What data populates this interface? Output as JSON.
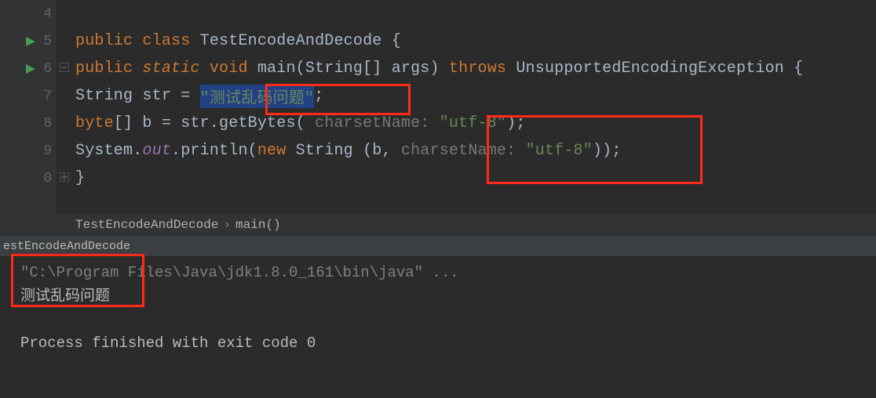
{
  "gutter": {
    "lines": [
      "4",
      "5",
      "6",
      "7",
      "8",
      "9",
      "0"
    ],
    "runMarkers": [
      1,
      2
    ],
    "foldOpen": 2,
    "foldClose": 6
  },
  "code": {
    "l5": {
      "kw1": "public ",
      "kw2": "class ",
      "name": "TestEncodeAndDecode ",
      "brace": "{"
    },
    "l6": {
      "kw1": "public ",
      "kw2": "static ",
      "kw3": "void ",
      "fn": "main",
      "p1": "(",
      "t1": "String",
      "arr": "[] ",
      "arg": "args",
      "p2": ") ",
      "kw4": "throws ",
      "exc": "UnsupportedEncodingException ",
      "brace": "{"
    },
    "l7": {
      "t": "String ",
      "id": "str ",
      "eq": "= ",
      "strlit": "\"测试乱码问题\"",
      "semi": ";"
    },
    "l8": {
      "t": "byte",
      "arr": "[] ",
      "id": "b ",
      "eq": "= ",
      "obj": "str",
      "dot": ".",
      "m": "getBytes",
      "p1": "( ",
      "hint": "charsetName: ",
      "strlit": "\"utf-8\"",
      "p2": ")",
      "semi": ";"
    },
    "l9": {
      "cls": "System",
      "d1": ".",
      "out": "out",
      "d2": ".",
      "m": "println",
      "p1": "(",
      "kw": "new ",
      "t": "String ",
      "p2": "(",
      "id": "b",
      "c": ", ",
      "hint": "charsetName: ",
      "strlit": "\"utf-8\"",
      "p3": "))",
      "semi": ";"
    },
    "l10": {
      "brace": "}"
    }
  },
  "breadcrumb": {
    "a": "TestEncodeAndDecode",
    "b": "main()"
  },
  "consoleHeader": "estEncodeAndDecode",
  "console": {
    "cmd": "\"C:\\Program Files\\Java\\jdk1.8.0_161\\bin\\java\" ...",
    "out": "测试乱码问题",
    "exit": "Process finished with exit code 0"
  }
}
